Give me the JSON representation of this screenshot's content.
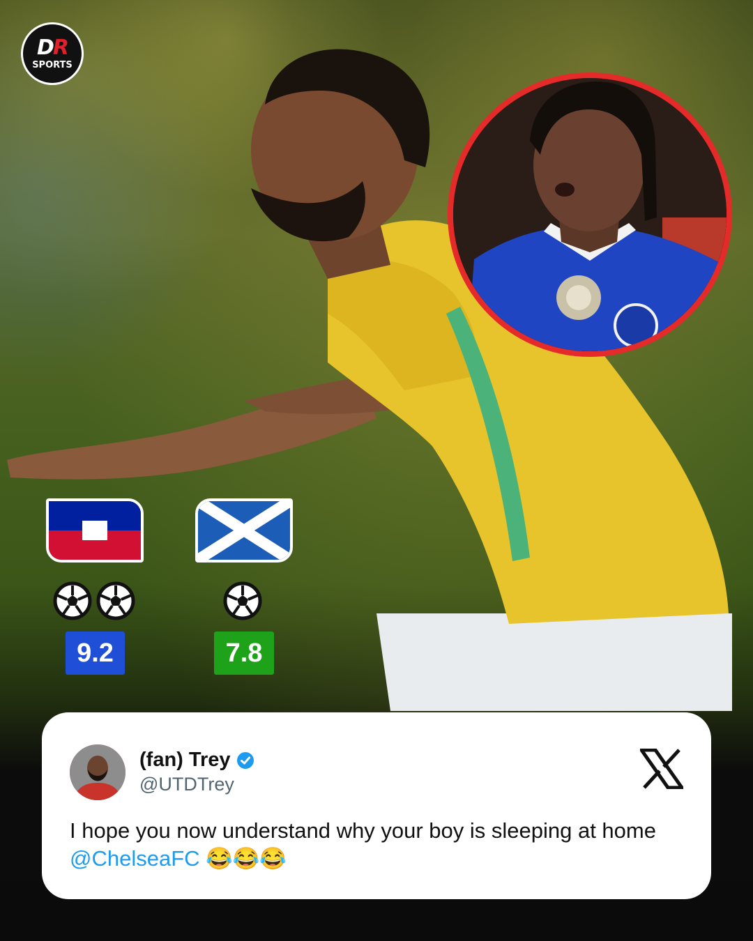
{
  "brand": {
    "logo_text_d": "D",
    "logo_text_r": "R",
    "logo_sub": "SPORTS"
  },
  "stats": [
    {
      "country": "Haiti",
      "flag_icon": "haiti-flag-icon",
      "goals": 2,
      "rating": "9.2",
      "rating_color": "#1f4fd6"
    },
    {
      "country": "Scotland",
      "flag_icon": "scotland-flag-icon",
      "goals": 1,
      "rating": "7.8",
      "rating_color": "#1ea21a"
    }
  ],
  "inset": {
    "border_color": "#e52a2a",
    "shirt_color": "#1f45c2"
  },
  "tweet": {
    "name": "(fan) Trey",
    "handle": "@UTDTrey",
    "text_before": "I hope you now understand why your boy is sleeping at home ",
    "mention": "@ChelseaFC",
    "emoji": "😂😂😂",
    "verified_color": "#1d9bf0",
    "platform_icon": "x-logo-icon"
  }
}
